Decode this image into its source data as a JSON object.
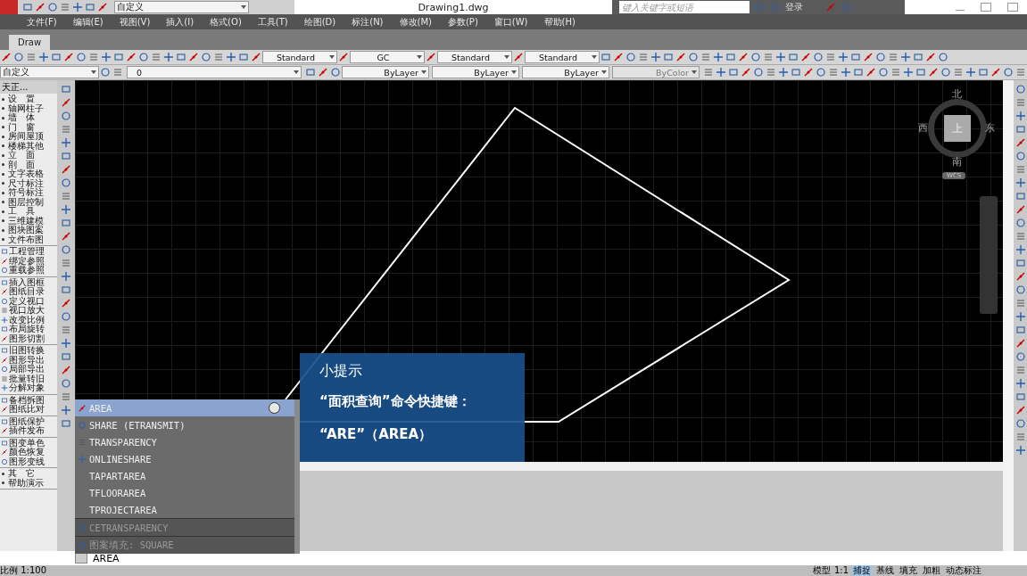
{
  "title_bar": {
    "workspace": "自定义",
    "title": "Drawing1.dwg",
    "search": {
      "placeholder": "键入关键字或短语"
    },
    "login": "登录"
  },
  "menu": [
    "文件(F)",
    "编辑(E)",
    "视图(V)",
    "插入(I)",
    "格式(O)",
    "工具(T)",
    "绘图(D)",
    "标注(N)",
    "修改(M)",
    "参数(P)",
    "窗口(W)",
    "帮助(H)"
  ],
  "tabs": [
    {
      "label": "Draw",
      "selected": true
    }
  ],
  "toolbar_1": {
    "dropdowns": [
      "Standard",
      "GC",
      "Standard",
      "Standard"
    ]
  },
  "toolbar_2": {
    "workspace": "自定义",
    "layer": "0",
    "color_control": "ByLayer",
    "linetype": "ByLayer",
    "lineweight": "ByLayer",
    "plot_style": {
      "value": "ByColor",
      "disabled": true
    }
  },
  "palette": {
    "title": "天正...",
    "groups": [
      {
        "kind": "bullet",
        "items": [
          "设　置",
          "轴网柱子",
          "墙　体",
          "门　窗",
          "房间屋顶",
          "楼梯其他",
          "立　面",
          "剖　面",
          "文字表格",
          "尺寸标注",
          "符号标注",
          "图层控制",
          "工　具",
          "三维建模",
          "图块图案",
          "文件布图"
        ]
      },
      {
        "kind": "icon",
        "items": [
          "工程管理",
          "绑定参照",
          "重载参照"
        ]
      },
      {
        "kind": "icon",
        "items": [
          "插入图框",
          "图纸目录",
          "定义视口",
          "视口放大",
          "改变比例",
          "布局旋转",
          "图形切割"
        ]
      },
      {
        "kind": "icon",
        "items": [
          "旧图转换",
          "图形导出",
          "局部导出",
          "批量转旧",
          "分解对象"
        ]
      },
      {
        "kind": "icon",
        "items": [
          "备档拆图",
          "图纸比对"
        ]
      },
      {
        "kind": "icon",
        "items": [
          "图纸保护",
          "插件发布"
        ]
      },
      {
        "kind": "icon",
        "items": [
          "图变单色",
          "颜色恢复",
          "图形变线"
        ]
      },
      {
        "kind": "bullet",
        "items": [
          "其　它",
          "帮助演示"
        ]
      }
    ]
  },
  "viewcube": {
    "north": "北",
    "south": "南",
    "east": "东",
    "west": "西",
    "face": "上",
    "ucs": "WCS"
  },
  "autocomplete": [
    {
      "kind": "command",
      "label": "AREA",
      "selected": true
    },
    {
      "kind": "command",
      "label": "SHARE (ETRANSMIT)",
      "selected": false
    },
    {
      "kind": "command",
      "label": "TRANSPARENCY",
      "selected": false
    },
    {
      "kind": "command",
      "label": "ONLINESHARE",
      "selected": false
    },
    {
      "kind": "command",
      "label": "TAPARTAREA",
      "selected": false
    },
    {
      "kind": "command",
      "label": "TFLOORAREA",
      "selected": false
    },
    {
      "kind": "command",
      "label": "TPROJECTAREA",
      "selected": false
    },
    {
      "kind": "variable",
      "label": "CETRANSPARENCY",
      "selected": false
    },
    {
      "kind": "pattern",
      "label": "图案填充: SQUARE",
      "selected": false
    }
  ],
  "tip": {
    "title": "小提示",
    "lines": [
      "“面积查询”命令快捷键：",
      "“ARE”（AREA）"
    ]
  },
  "command_line": {
    "value": "AREA"
  },
  "status_bar": {
    "scale": "比例 1:100",
    "model": "模型",
    "annotation_scale": "1:1",
    "toggles": [
      {
        "label": "捕捉",
        "selected": true
      },
      {
        "label": "基线",
        "selected": false
      },
      {
        "label": "填充",
        "selected": false
      },
      {
        "label": "加粗",
        "selected": false
      },
      {
        "label": "动态标注",
        "selected": false
      }
    ]
  }
}
